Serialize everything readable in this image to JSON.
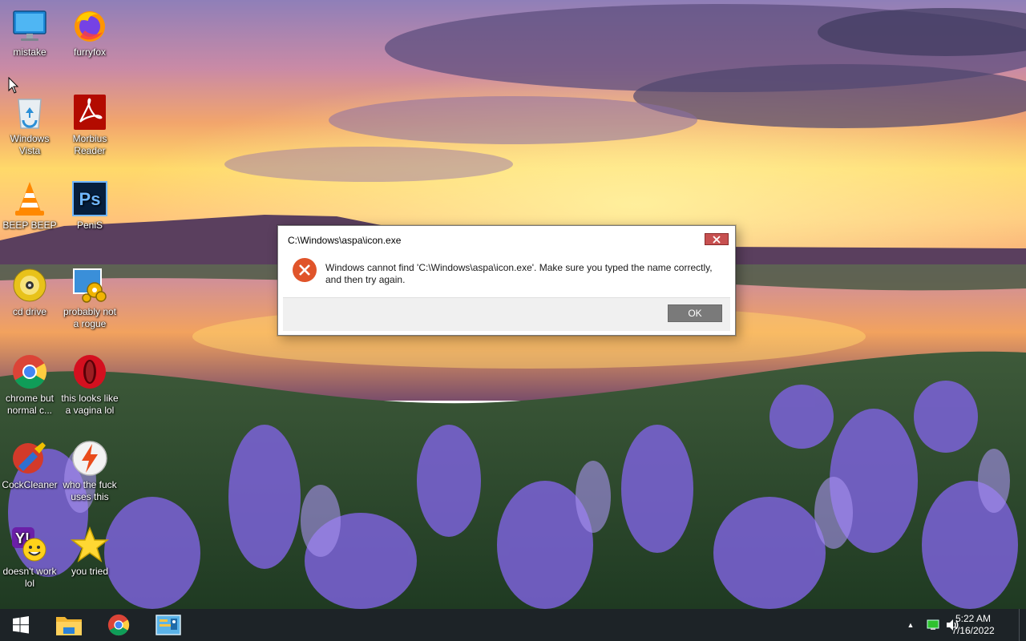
{
  "desktop": {
    "icons": [
      {
        "label": "mistake",
        "icon": "monitor-icon"
      },
      {
        "label": "furryfox",
        "icon": "firefox-icon"
      },
      {
        "label": "Windows Vista",
        "icon": "recycle-bin-icon"
      },
      {
        "label": "Morbius Reader",
        "icon": "pdf-reader-icon"
      },
      {
        "label": "BEEP BEEP",
        "icon": "vlc-cone-icon"
      },
      {
        "label": "PeniS",
        "icon": "photoshop-icon"
      },
      {
        "label": "cd drive",
        "icon": "cd-drive-icon"
      },
      {
        "label": "probably not a rogue",
        "icon": "gears-program-icon"
      },
      {
        "label": "chrome but normal c...",
        "icon": "chrome-icon"
      },
      {
        "label": "this looks like a vagina lol",
        "icon": "opera-icon"
      },
      {
        "label": "CockCleaner",
        "icon": "ccleaner-icon"
      },
      {
        "label": "who the fuck uses this",
        "icon": "lightning-icon"
      },
      {
        "label": "doesn't work lol",
        "icon": "yahoo-messenger-icon"
      },
      {
        "label": "you tried",
        "icon": "star-icon"
      }
    ]
  },
  "dialog": {
    "title": "C:\\Windows\\aspa\\icon.exe",
    "message": "Windows cannot find 'C:\\Windows\\aspa\\icon.exe'. Make sure you typed the name correctly, and then try again.",
    "ok_label": "OK",
    "close_glyph": "✕"
  },
  "taskbar": {
    "pinned": [
      "start-icon",
      "file-explorer-icon",
      "chrome-icon",
      "control-panel-icon"
    ],
    "tray": {
      "chevron": "▲",
      "time": "5:22 AM",
      "date": "7/16/2022"
    }
  },
  "colors": {
    "taskbar": "#1d2327",
    "error": "#e0542a",
    "close_button": "#c75050",
    "ok_button": "#7a7a7a"
  }
}
